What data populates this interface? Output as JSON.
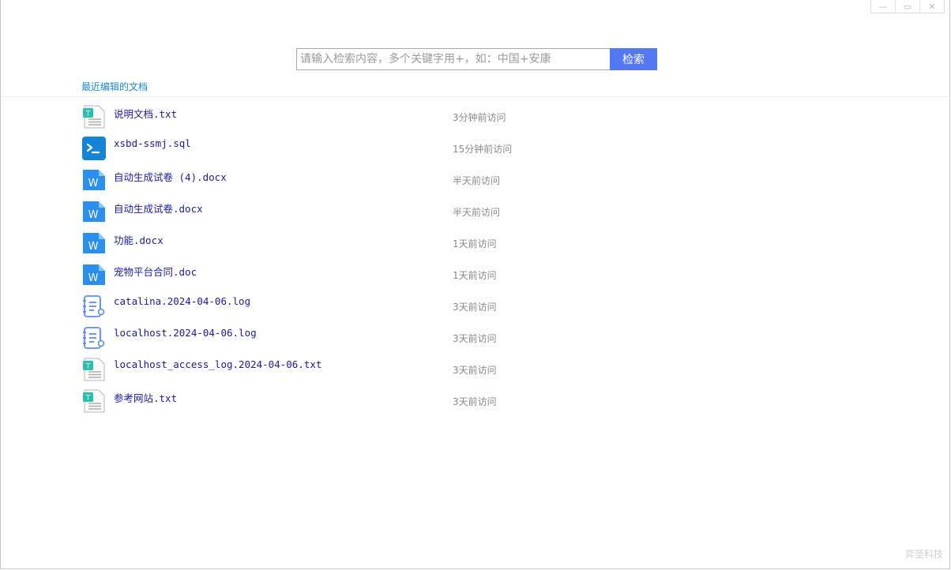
{
  "window_controls": {
    "minimize": "—",
    "maximize": "▭",
    "close": "✕"
  },
  "search": {
    "placeholder": "请输入检索内容，多个关键字用+，如：中国+安康",
    "button": "检索"
  },
  "section_title": "最近编辑的文档",
  "files": [
    {
      "name": "说明文档.txt",
      "time": "3分钟前访问",
      "icon": "txt-file-icon"
    },
    {
      "name": "xsbd-ssmj.sql",
      "time": "15分钟前访问",
      "icon": "sql-terminal-icon"
    },
    {
      "name": "自动生成试卷 (4).docx",
      "time": "半天前访问",
      "icon": "word-file-icon"
    },
    {
      "name": "自动生成试卷.docx",
      "time": "半天前访问",
      "icon": "word-file-icon"
    },
    {
      "name": "功能.docx",
      "time": "1天前访问",
      "icon": "word-file-icon"
    },
    {
      "name": "宠物平台合同.doc",
      "time": "1天前访问",
      "icon": "word-file-icon"
    },
    {
      "name": "catalina.2024-04-06.log",
      "time": "3天前访问",
      "icon": "log-file-icon"
    },
    {
      "name": "localhost.2024-04-06.log",
      "time": "3天前访问",
      "icon": "log-file-icon"
    },
    {
      "name": "localhost_access_log.2024-04-06.txt",
      "time": "3天前访问",
      "icon": "txt-file-icon"
    },
    {
      "name": "参考网站.txt",
      "time": "3天前访问",
      "icon": "txt-file-icon"
    }
  ],
  "brand": "弈圣科技",
  "colors": {
    "accent": "#5478f3",
    "link": "#1a1aa6",
    "section": "#1c8bd1",
    "word": "#2b8ff0",
    "sql": "#1684d6",
    "txt": "#2bbfb0",
    "log": "#5b8cf0"
  }
}
